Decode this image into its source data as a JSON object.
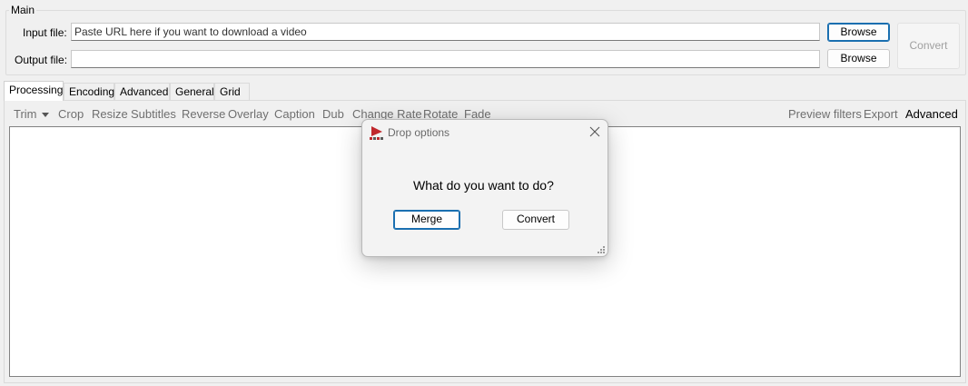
{
  "main_group": {
    "title": "Main",
    "input_label": "Input file:",
    "input_value": "Paste URL here if you want to download a video",
    "output_label": "Output file:",
    "output_value": "",
    "browse_label": "Browse",
    "convert_label": "Convert"
  },
  "tabs": [
    {
      "label": "Processing",
      "active": true
    },
    {
      "label": "Encoding",
      "active": false
    },
    {
      "label": "Advanced",
      "active": false
    },
    {
      "label": "General",
      "active": false
    },
    {
      "label": "Grid",
      "active": false
    }
  ],
  "toolbar": {
    "left_items": [
      "Trim",
      "Crop",
      "Resize",
      "Subtitles",
      "Reverse",
      "Overlay",
      "Caption",
      "Dub",
      "Change Rate",
      "Rotate",
      "Fade"
    ],
    "right_items": [
      "Preview filters",
      "Export",
      "Advanced"
    ]
  },
  "dialog": {
    "title": "Drop options",
    "question": "What do you want to do?",
    "merge_label": "Merge",
    "convert_label": "Convert",
    "close_icon": "close-icon",
    "app_icon": "app-logo-icon"
  },
  "colors": {
    "background": "#f0f0f0",
    "focus_border": "#1a6fb0",
    "app_logo": "#c0282d"
  }
}
